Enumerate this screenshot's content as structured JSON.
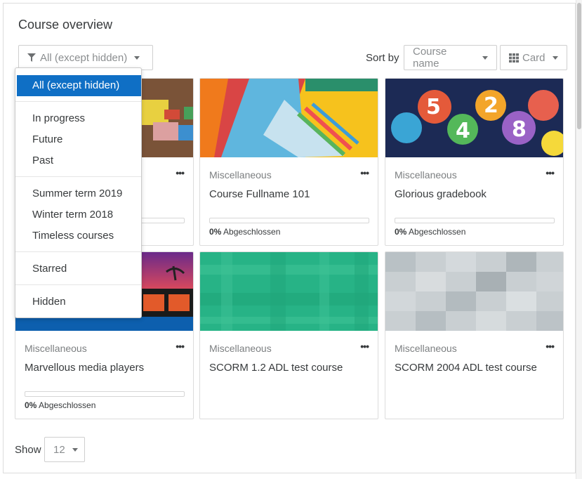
{
  "title": "Course overview",
  "filter": {
    "label": "All (except hidden)",
    "options": [
      "All (except hidden)",
      "In progress",
      "Future",
      "Past",
      "Summer term 2019",
      "Winter term 2018",
      "Timeless courses",
      "Starred",
      "Hidden"
    ],
    "selected": "All (except hidden)"
  },
  "sort": {
    "label": "Sort by",
    "value": "Course name"
  },
  "view": {
    "value": "Card"
  },
  "dots": "•••",
  "progress_suffix": "Abgeschlossen",
  "courses": [
    {
      "category": "",
      "name": "",
      "progress": "",
      "progress_value": 0
    },
    {
      "category": "Miscellaneous",
      "name": "Course Fullname 101",
      "progress": "0%",
      "progress_value": 0
    },
    {
      "category": "Miscellaneous",
      "name": "Glorious gradebook",
      "progress": "0%",
      "progress_value": 0
    },
    {
      "category": "Miscellaneous",
      "name": "Marvellous media players",
      "progress": "0%",
      "progress_value": 0
    },
    {
      "category": "Miscellaneous",
      "name": "SCORM 1.2 ADL test course"
    },
    {
      "category": "Miscellaneous",
      "name": "SCORM 2004 ADL test course"
    }
  ],
  "paging": {
    "label": "Show",
    "value": "12"
  },
  "colors": {
    "accent": "#0f6fc5",
    "border": "#dcdcdc",
    "muted": "#7c7f81"
  }
}
